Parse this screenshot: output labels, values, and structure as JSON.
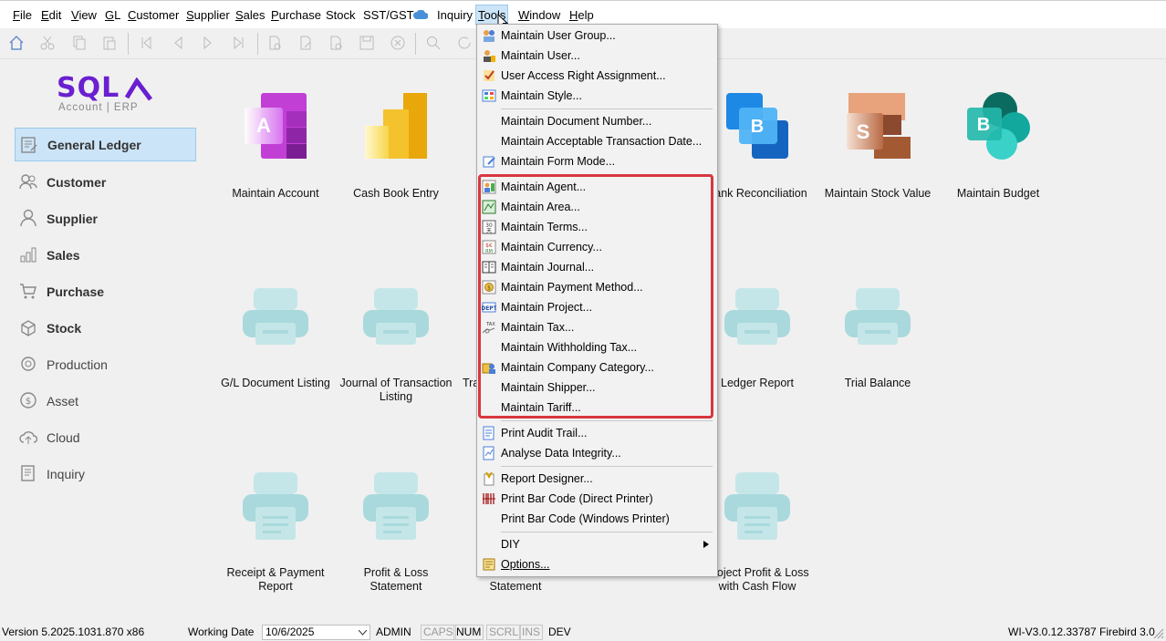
{
  "menubar": {
    "items": [
      {
        "label": "File",
        "ul": "F",
        "rest": "ile"
      },
      {
        "label": "Edit",
        "ul": "E",
        "rest": "dit"
      },
      {
        "label": "View",
        "ul": "V",
        "rest": "iew"
      },
      {
        "label": "GL",
        "ul": "G",
        "rest": "L"
      },
      {
        "label": "Customer",
        "ul": "C",
        "rest": "ustomer"
      },
      {
        "label": "Supplier",
        "ul": "S",
        "rest": "upplier"
      },
      {
        "label": "Sales",
        "ul": "S",
        "rest": "ales"
      },
      {
        "label": "Purchase",
        "ul": "P",
        "rest": "urchase"
      },
      {
        "label": "Stock",
        "ul": "",
        "rest": "Stock"
      },
      {
        "label": "SST/GST",
        "ul": "",
        "rest": "SST/GST"
      },
      {
        "label": "Inquiry",
        "ul": "",
        "rest": "Inquiry"
      },
      {
        "label": "Tools",
        "ul": "T",
        "rest": "ools"
      },
      {
        "label": "Window",
        "ul": "W",
        "rest": "indow"
      },
      {
        "label": "Help",
        "ul": "H",
        "rest": "elp"
      }
    ]
  },
  "logo": {
    "brand": "SQL",
    "sub": "Account | ERP"
  },
  "sidebar": {
    "items": [
      {
        "label": "General Ledger"
      },
      {
        "label": "Customer"
      },
      {
        "label": "Supplier"
      },
      {
        "label": "Sales"
      },
      {
        "label": "Purchase"
      },
      {
        "label": "Stock"
      },
      {
        "label": "Production"
      },
      {
        "label": "Asset"
      },
      {
        "label": "Cloud"
      },
      {
        "label": "Inquiry"
      }
    ]
  },
  "tiles": {
    "row1": [
      "Maintain Account",
      "Cash Book Entry",
      "ank Reconciliation",
      "Maintain Stock Value",
      "Maintain Budget"
    ],
    "row1_letters": {
      "account": "A",
      "bank": "B",
      "stock": "S",
      "budget": "B"
    },
    "row2": [
      "G/L Document Listing",
      "Journal of Transaction",
      "Listing",
      "Tra",
      "Ledger Report",
      "Trial Balance"
    ],
    "row3": [
      "Receipt & Payment",
      "Report",
      "Profit & Loss",
      "Statement",
      "Statement",
      "Project Profit & Loss",
      "with Cash Flow"
    ]
  },
  "dropdown": {
    "items": [
      "Maintain User Group...",
      "Maintain User...",
      "User Access Right Assignment...",
      "Maintain Style...",
      "Maintain Document Number...",
      "Maintain Acceptable Transaction Date...",
      "Maintain Form Mode...",
      "Maintain Agent...",
      "Maintain Area...",
      "Maintain Terms...",
      "Maintain Currency...",
      "Maintain Journal...",
      "Maintain Payment Method...",
      "Maintain Project...",
      "Maintain Tax...",
      "Maintain Withholding Tax...",
      "Maintain Company Category...",
      "Maintain Shipper...",
      "Maintain Tariff...",
      "Print Audit Trail...",
      "Analyse Data Integrity...",
      "Report Designer...",
      "Print Bar Code (Direct Printer)",
      "Print Bar Code (Windows Printer)",
      "DIY",
      "Options..."
    ]
  },
  "status": {
    "version": "Version 5.2025.1031.870 x86",
    "working_date_label": "Working Date",
    "working_date": "10/6/2025",
    "user": "ADMIN",
    "caps": "CAPS",
    "num": "NUM",
    "scrl": "SCRL",
    "ins": "INS",
    "dev": "DEV",
    "server": "WI-V3.0.12.33787 Firebird 3.0"
  },
  "colors": {
    "brand_purple": "#6a1fd0",
    "highlight_red": "#d9363e",
    "selection_blue": "#cce4f7"
  }
}
